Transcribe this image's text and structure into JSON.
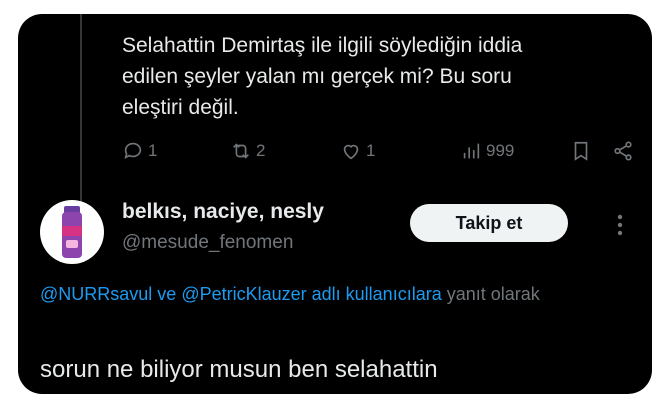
{
  "parent_tweet": {
    "lines": [
      "Selahattin Demirtaş ile ilgili söylediğin iddia",
      "edilen şeyler yalan mı gerçek mi? Bu soru",
      "eleştiri değil."
    ],
    "actions": {
      "reply_count": "1",
      "retweet_count": "2",
      "like_count": "1",
      "view_count": "999"
    }
  },
  "reply_tweet": {
    "display_name": "belkıs, naciye, nesly",
    "handle": "@mesude_fenomen",
    "follow_label": "Takip et",
    "reply_context": {
      "mention_1": "@NURRsavul",
      "connector": " ve ",
      "mention_2": "@PetricKlauzer",
      "suffix_link": " adlı kullanıcılara",
      "suffix_text": " yanıt olarak"
    },
    "text": "sorun ne biliyor musun ben selahattin"
  },
  "icons": {
    "reply": "comment-icon",
    "retweet": "retweet-icon",
    "like": "heart-icon",
    "views": "views-icon",
    "bookmark": "bookmark-icon",
    "share": "share-icon",
    "more": "more-dots-icon"
  },
  "colors": {
    "background": "#000000",
    "text": "#e7e9ea",
    "muted": "#71767b",
    "link": "#1d9bf0",
    "button_bg": "#eff3f4"
  }
}
